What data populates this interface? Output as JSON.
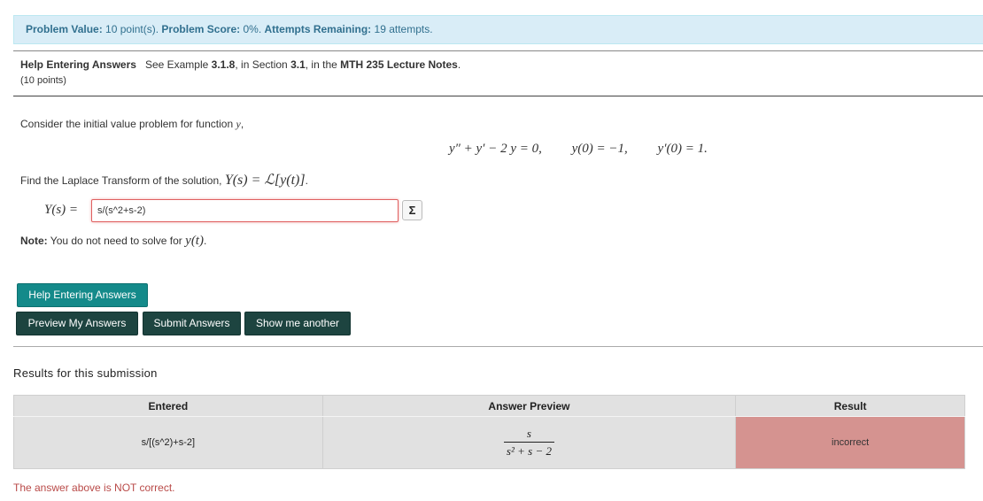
{
  "score_bar": {
    "value_label": "Problem Value:",
    "value_text": "10 point(s).",
    "score_label": "Problem Score:",
    "score_text": "0%.",
    "attempts_label": "Attempts Remaining:",
    "attempts_text": "19 attempts."
  },
  "header": {
    "help_label": "Help Entering Answers",
    "see_text": "See Example",
    "example_ref": "3.1.8",
    "in_section_text": ", in Section",
    "section_ref": "3.1",
    "in_the_text": ", in the",
    "notes_ref": "MTH 235 Lecture Notes",
    "period": ".",
    "points": "(10 points)"
  },
  "problem": {
    "intro_text": "Consider the initial value problem for function",
    "intro_var": "y",
    "intro_punct": ",",
    "equation_ode": "y″ + y′ − 2 y = 0,",
    "equation_ic1": "y(0) = −1,",
    "equation_ic2": "y′(0) = 1.",
    "find_text": "Find the Laplace Transform of the solution,",
    "find_math": "Y(s) = ℒ[y(t)]",
    "find_punct": ".",
    "answer_label": "Y(s) =",
    "answer_value": "s/(s^2+s-2)",
    "equation_button_icon": "Σ",
    "note_label": "Note:",
    "note_text": "You do not need to solve for",
    "note_math": "y(t)",
    "note_punct": "."
  },
  "buttons": {
    "help": "Help Entering Answers",
    "preview": "Preview My Answers",
    "submit": "Submit Answers",
    "another": "Show me another"
  },
  "results": {
    "title": "Results for this submission",
    "columns": [
      "Entered",
      "Answer Preview",
      "Result"
    ],
    "rows": [
      {
        "entered": "s/[(s^2)+s-2]",
        "preview_num": "s",
        "preview_den": "s² + s − 2",
        "result": "incorrect"
      }
    ],
    "feedback": "The answer above is NOT correct."
  },
  "colors": {
    "score_bar_bg": "#d9edf7",
    "score_bar_text": "#31708f",
    "button_help": "#148a8a",
    "button_dark": "#1d4440",
    "incorrect_cell": "#d59390",
    "error_text": "#b94a48"
  }
}
